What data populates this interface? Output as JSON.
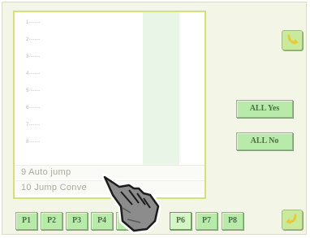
{
  "list": {
    "items": [
      {
        "label": "1------"
      },
      {
        "label": "2------"
      },
      {
        "label": "3------"
      },
      {
        "label": "4------"
      },
      {
        "label": "5------"
      },
      {
        "label": "6------"
      },
      {
        "label": "7------"
      },
      {
        "label": "8------"
      },
      {
        "label": "9 Auto jump"
      },
      {
        "label": "10 Jump Conve"
      }
    ]
  },
  "buttons": {
    "all_yes": "ALL Yes",
    "all_no": "ALL No"
  },
  "pages": [
    {
      "label": "P1"
    },
    {
      "label": "P2"
    },
    {
      "label": "P3"
    },
    {
      "label": "P4"
    },
    {
      "label": "P5"
    },
    {
      "label": "P6",
      "selected": true
    },
    {
      "label": "P7"
    },
    {
      "label": "P8"
    }
  ],
  "icons": {
    "top_right": "return-arrow-icon",
    "bottom_right": "enter-arrow-icon",
    "cursor": "hand-pointer-cursor"
  },
  "colors": {
    "button_green": "#b8eaa9",
    "panel_border": "#d6e07a",
    "background": "#f3f6e6"
  }
}
